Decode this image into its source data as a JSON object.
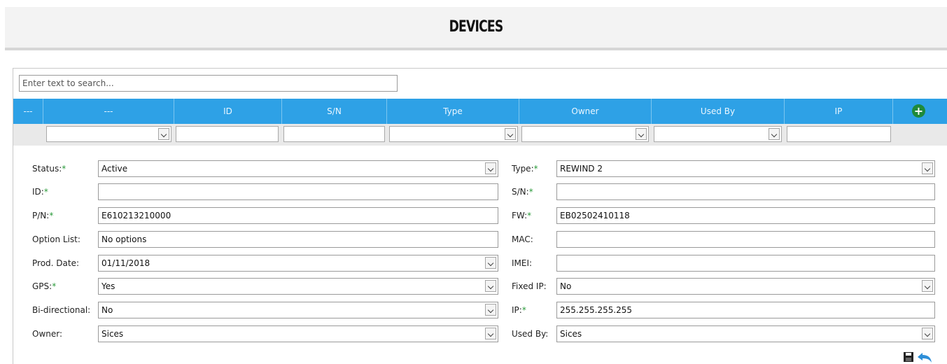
{
  "page": {
    "title": "DEVICES"
  },
  "search": {
    "placeholder": "Enter text to search..."
  },
  "grid": {
    "columns": [
      "---",
      "---",
      "ID",
      "S/N",
      "Type",
      "Owner",
      "Used By",
      "IP"
    ],
    "add_icon": "plus-circle-icon"
  },
  "form": {
    "status": {
      "label": "Status:",
      "value": "Active"
    },
    "id": {
      "label": "ID:",
      "value": ""
    },
    "pn": {
      "label": "P/N:",
      "value": "E610213210000"
    },
    "option_list": {
      "label": "Option List:",
      "value": "No options"
    },
    "prod_date": {
      "label": "Prod. Date:",
      "value": "01/11/2018"
    },
    "gps": {
      "label": "GPS:",
      "value": "Yes"
    },
    "bidirectional": {
      "label": "Bi-directional:",
      "value": "No"
    },
    "owner": {
      "label": "Owner:",
      "value": "Sices"
    },
    "type": {
      "label": "Type:",
      "value": "REWIND 2"
    },
    "sn": {
      "label": "S/N:",
      "value": ""
    },
    "fw": {
      "label": "FW:",
      "value": "EB02502410118"
    },
    "mac": {
      "label": "MAC:",
      "value": ""
    },
    "imei": {
      "label": "IMEI:",
      "value": ""
    },
    "fixed_ip": {
      "label": "Fixed IP:",
      "value": "No"
    },
    "ip": {
      "label": "IP:",
      "value": "255.255.255.255"
    },
    "used_by": {
      "label": "Used By:",
      "value": "Sices"
    },
    "required_mark": "*"
  },
  "actions": {
    "save_icon": "save-icon",
    "undo_icon": "undo-icon"
  },
  "colors": {
    "header_blue": "#2ea1e6",
    "add_green": "#1f8a3b",
    "required_green": "#2a9a3a",
    "undo_blue": "#2e8fd8"
  }
}
